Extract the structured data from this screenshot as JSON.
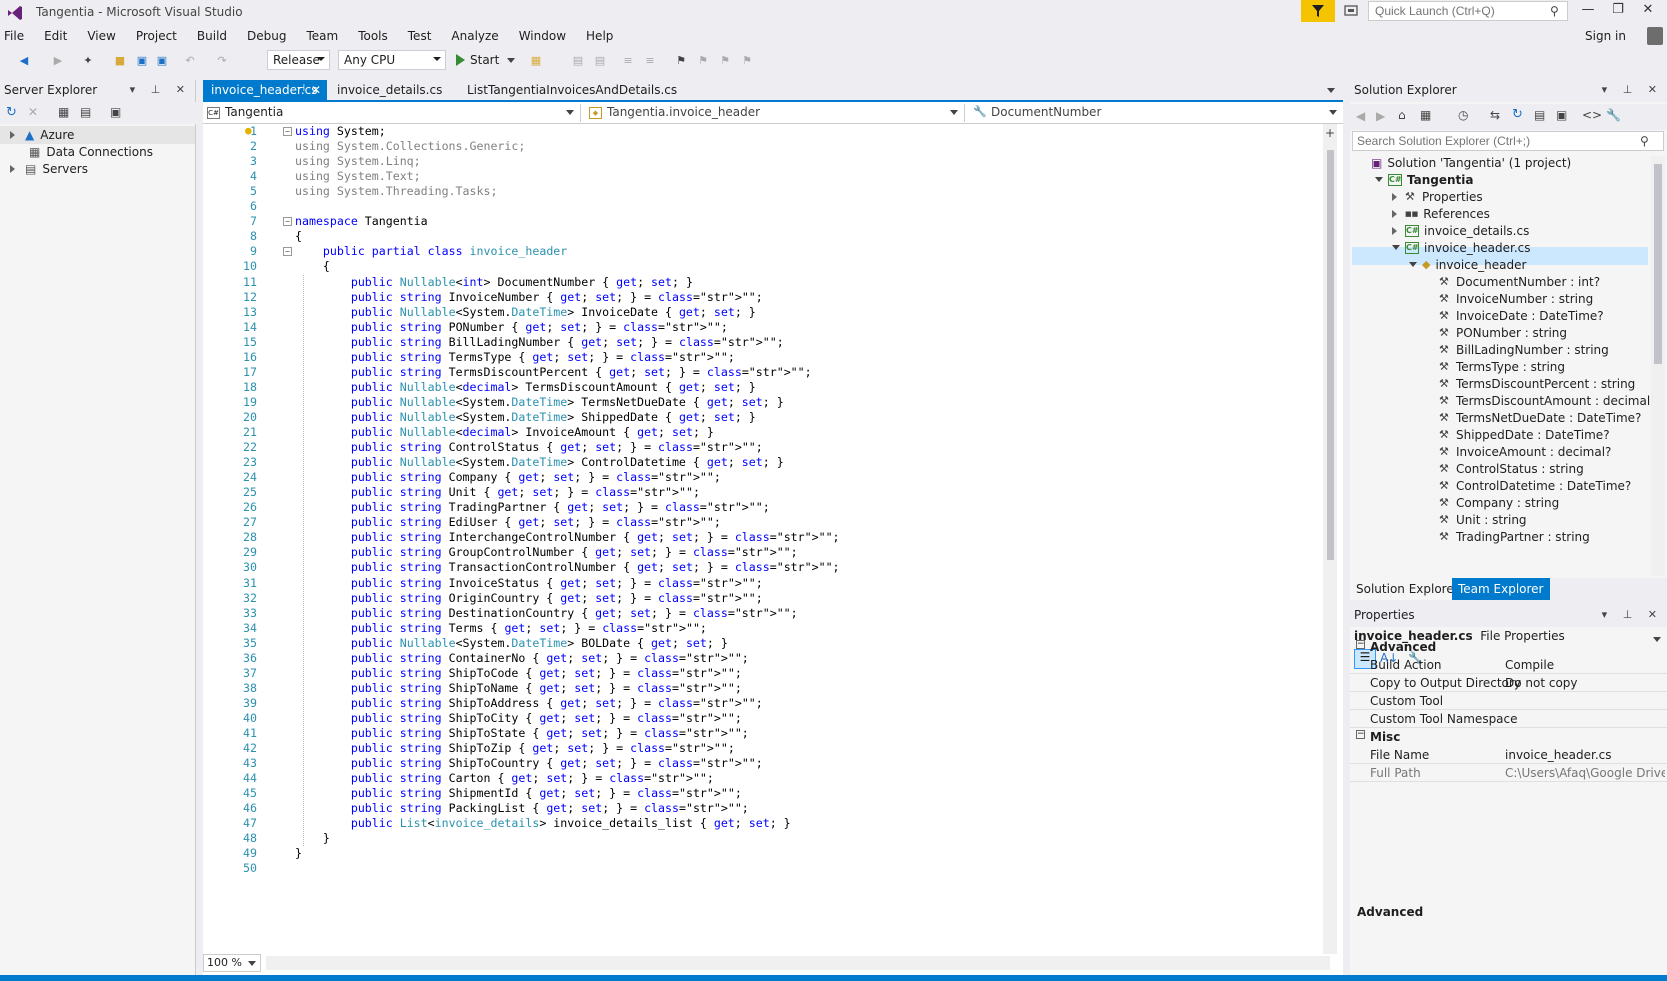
{
  "window": {
    "title": "Tangentia - Microsoft Visual Studio",
    "quick_launch_placeholder": "Quick Launch (Ctrl+Q)",
    "sign_in": "Sign in"
  },
  "menu": [
    "File",
    "Edit",
    "View",
    "Project",
    "Build",
    "Debug",
    "Team",
    "Tools",
    "Test",
    "Analyze",
    "Window",
    "Help"
  ],
  "toolbar": {
    "configuration": "Release",
    "platform": "Any CPU",
    "start_label": "Start"
  },
  "server_explorer": {
    "title": "Server Explorer",
    "items": [
      "Azure",
      "Data Connections",
      "Servers"
    ]
  },
  "editor": {
    "tabs": [
      "invoice_header.cs",
      "invoice_details.cs",
      "ListTangentiaInvoicesAndDetails.cs"
    ],
    "nav": [
      "Tangentia",
      "Tangentia.invoice_header",
      "DocumentNumber"
    ],
    "zoom": "100 %"
  },
  "code_lines": [
    "using System;",
    "using System.Collections.Generic;",
    "using System.Linq;",
    "using System.Text;",
    "using System.Threading.Tasks;",
    "",
    "namespace Tangentia",
    "{",
    "    public partial class invoice_header",
    "    {",
    "        public Nullable<int> DocumentNumber { get; set; }",
    "        public string InvoiceNumber { get; set; } = \"\";",
    "        public Nullable<System.DateTime> InvoiceDate { get; set; }",
    "        public string PONumber { get; set; } = \"\";",
    "        public string BillLadingNumber { get; set; } = \"\";",
    "        public string TermsType { get; set; } = \"\";",
    "        public string TermsDiscountPercent { get; set; } = \"\";",
    "        public Nullable<decimal> TermsDiscountAmount { get; set; }",
    "        public Nullable<System.DateTime> TermsNetDueDate { get; set; }",
    "        public Nullable<System.DateTime> ShippedDate { get; set; }",
    "        public Nullable<decimal> InvoiceAmount { get; set; }",
    "        public string ControlStatus { get; set; } = \"\";",
    "        public Nullable<System.DateTime> ControlDatetime { get; set; }",
    "        public string Company { get; set; } = \"\";",
    "        public string Unit { get; set; } = \"\";",
    "        public string TradingPartner { get; set; } = \"\";",
    "        public string EdiUser { get; set; } = \"\";",
    "        public string InterchangeControlNumber { get; set; } = \"\";",
    "        public string GroupControlNumber { get; set; } = \"\";",
    "        public string TransactionControlNumber { get; set; } = \"\";",
    "        public string InvoiceStatus { get; set; } = \"\";",
    "        public string OriginCountry { get; set; } = \"\";",
    "        public string DestinationCountry { get; set; } = \"\";",
    "        public string Terms { get; set; } = \"\";",
    "        public Nullable<System.DateTime> BOLDate { get; set; }",
    "        public string ContainerNo { get; set; } = \"\";",
    "        public string ShipToCode { get; set; } = \"\";",
    "        public string ShipToName { get; set; } = \"\";",
    "        public string ShipToAddress { get; set; } = \"\";",
    "        public string ShipToCity { get; set; } = \"\";",
    "        public string ShipToState { get; set; } = \"\";",
    "        public string ShipToZip { get; set; } = \"\";",
    "        public string ShipToCountry { get; set; } = \"\";",
    "        public string Carton { get; set; } = \"\";",
    "        public string ShipmentId { get; set; } = \"\";",
    "        public string PackingList { get; set; } = \"\";",
    "        public List<invoice_details> invoice_details_list { get; set; }",
    "    }",
    "}",
    ""
  ],
  "solution_explorer": {
    "title": "Solution Explorer",
    "search_placeholder": "Search Solution Explorer (Ctrl+;)",
    "solution": "Solution 'Tangentia' (1 project)",
    "project": "Tangentia",
    "nodes": [
      "Properties",
      "References",
      "invoice_details.cs",
      "invoice_header.cs"
    ],
    "class": "invoice_header",
    "members": [
      "DocumentNumber : int?",
      "InvoiceNumber : string",
      "InvoiceDate : DateTime?",
      "PONumber : string",
      "BillLadingNumber : string",
      "TermsType : string",
      "TermsDiscountPercent : string",
      "TermsDiscountAmount : decimal?",
      "TermsNetDueDate : DateTime?",
      "ShippedDate : DateTime?",
      "InvoiceAmount : decimal?",
      "ControlStatus : string",
      "ControlDatetime : DateTime?",
      "Company : string",
      "Unit : string",
      "TradingPartner : string"
    ],
    "bottom_tabs": [
      "Solution Explorer",
      "Team Explorer"
    ]
  },
  "properties": {
    "title": "Properties",
    "object_name": "invoice_header.cs",
    "object_type": "File Properties",
    "categories": [
      {
        "name": "Advanced",
        "rows": [
          {
            "k": "Build Action",
            "v": "Compile"
          },
          {
            "k": "Copy to Output Directory",
            "v": "Do not copy"
          },
          {
            "k": "Custom Tool",
            "v": ""
          },
          {
            "k": "Custom Tool Namespace",
            "v": ""
          }
        ]
      },
      {
        "name": "Misc",
        "rows": [
          {
            "k": "File Name",
            "v": "invoice_header.cs"
          },
          {
            "k": "Full Path",
            "v": "C:\\Users\\Afaq\\Google Drive\\A"
          }
        ]
      }
    ],
    "description_title": "Advanced"
  }
}
